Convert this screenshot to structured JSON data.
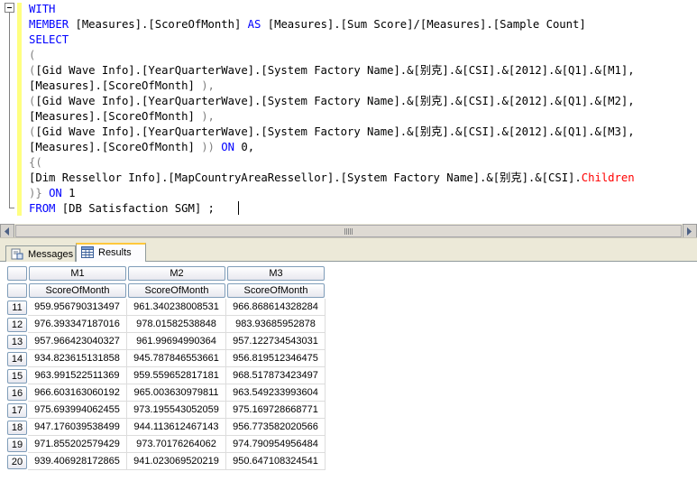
{
  "editor": {
    "lines": [
      [
        {
          "t": "WITH",
          "c": "kw"
        }
      ],
      [
        {
          "t": "MEMBER",
          "c": "kw"
        },
        {
          "t": " [Measures].[ScoreOfMonth] "
        },
        {
          "t": "AS",
          "c": "kw"
        },
        {
          "t": " [Measures].[Sum Score]/[Measures].[Sample Count]"
        }
      ],
      [
        {
          "t": "SELECT",
          "c": "kw"
        }
      ],
      [
        {
          "t": "(",
          "c": "gray"
        }
      ],
      [
        {
          "t": "(",
          "c": "gray"
        },
        {
          "t": "[Gid Wave Info].[YearQuarterWave].[System Factory Name].&[别克].&[CSI].&[2012].&[Q1].&[M1],"
        }
      ],
      [
        {
          "t": "[Measures].[ScoreOfMonth] "
        },
        {
          "t": "),",
          "c": "gray"
        }
      ],
      [
        {
          "t": "(",
          "c": "gray"
        },
        {
          "t": "[Gid Wave Info].[YearQuarterWave].[System Factory Name].&[别克].&[CSI].&[2012].&[Q1].&[M2],"
        }
      ],
      [
        {
          "t": "[Measures].[ScoreOfMonth] "
        },
        {
          "t": "),",
          "c": "gray"
        }
      ],
      [
        {
          "t": "(",
          "c": "gray"
        },
        {
          "t": "[Gid Wave Info].[YearQuarterWave].[System Factory Name].&[别克].&[CSI].&[2012].&[Q1].&[M3],"
        }
      ],
      [
        {
          "t": "[Measures].[ScoreOfMonth] "
        },
        {
          "t": "))",
          "c": "gray"
        },
        {
          "t": " "
        },
        {
          "t": "ON",
          "c": "kw"
        },
        {
          "t": " 0,"
        }
      ],
      [
        {
          "t": "{(",
          "c": "gray"
        }
      ],
      [
        {
          "t": "[Dim Ressellor Info].[MapCountryAreaRessellor].[System Factory Name].&[别克].&[CSI]."
        },
        {
          "t": "Children",
          "c": "red"
        }
      ],
      [
        {
          "t": ")}",
          "c": "gray"
        },
        {
          "t": " "
        },
        {
          "t": "ON",
          "c": "kw"
        },
        {
          "t": " 1"
        }
      ],
      [
        {
          "t": "FROM",
          "c": "kw"
        },
        {
          "t": " [DB Satisfaction SGM] ; "
        }
      ]
    ]
  },
  "tabs": {
    "messages": "Messages",
    "results": "Results"
  },
  "grid": {
    "columns": [
      "M1",
      "M2",
      "M3"
    ],
    "subheaders": [
      "ScoreOfMonth",
      "ScoreOfMonth",
      "ScoreOfMonth"
    ],
    "rows": [
      {
        "n": "11",
        "v": [
          "959.956790313497",
          "961.340238008531",
          "966.868614328284"
        ]
      },
      {
        "n": "12",
        "v": [
          "976.393347187016",
          "978.01582538848",
          "983.93685952878"
        ]
      },
      {
        "n": "13",
        "v": [
          "957.966423040327",
          "961.99694990364",
          "957.122734543031"
        ]
      },
      {
        "n": "14",
        "v": [
          "934.823615131858",
          "945.787846553661",
          "956.819512346475"
        ]
      },
      {
        "n": "15",
        "v": [
          "963.991522511369",
          "959.559652817181",
          "968.517873423497"
        ]
      },
      {
        "n": "16",
        "v": [
          "966.603163060192",
          "965.003630979811",
          "963.549233993604"
        ]
      },
      {
        "n": "17",
        "v": [
          "975.693994062455",
          "973.195543052059",
          "975.169728668771"
        ]
      },
      {
        "n": "18",
        "v": [
          "947.176039538499",
          "944.113612467143",
          "956.773582020566"
        ]
      },
      {
        "n": "19",
        "v": [
          "971.855202579429",
          "973.70176264062",
          "974.790954956484"
        ]
      },
      {
        "n": "20",
        "v": [
          "939.406928172865",
          "941.023069520219",
          "950.647108324541"
        ]
      }
    ]
  }
}
